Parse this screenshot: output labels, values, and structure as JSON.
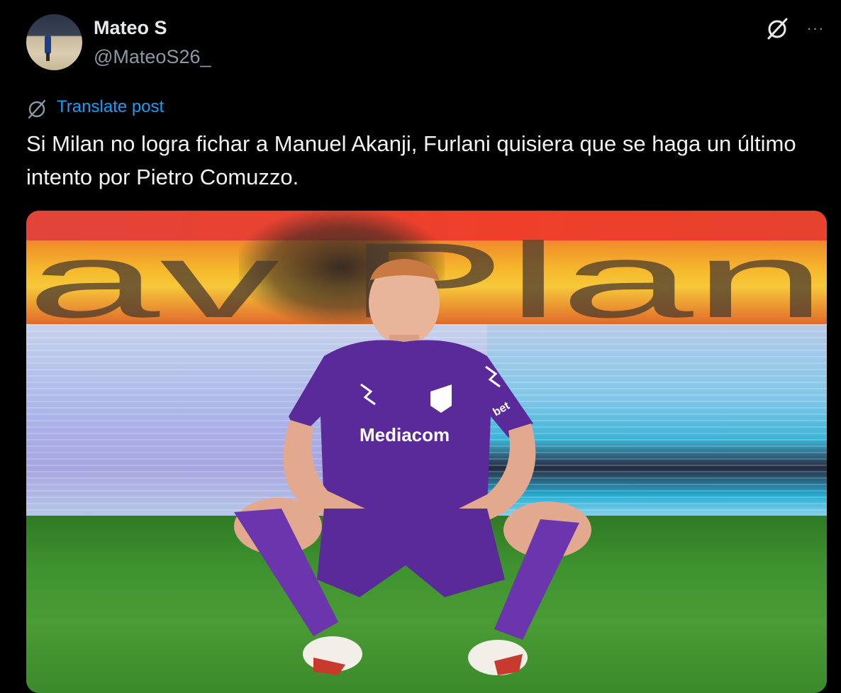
{
  "author": {
    "name": "Mateo S",
    "handle": "@MateoS26_"
  },
  "actions": {
    "grok_icon": "slashed-circle-icon",
    "more_label": "···"
  },
  "translate": {
    "label": "Translate post"
  },
  "post": {
    "text": "Si Milan no logra fichar a Manuel Akanji, Furlani quisiera que se haga un último intento por Pietro Comuzzo."
  },
  "media": {
    "board_text": "av Plan",
    "jersey_sponsor": "Mediacom",
    "sleeve_text": "bet"
  },
  "colors": {
    "background": "#000000",
    "text": "#e7e9ea",
    "muted": "#8b98a5",
    "link": "#1d9bf0",
    "jersey": "#5b2a9a"
  }
}
